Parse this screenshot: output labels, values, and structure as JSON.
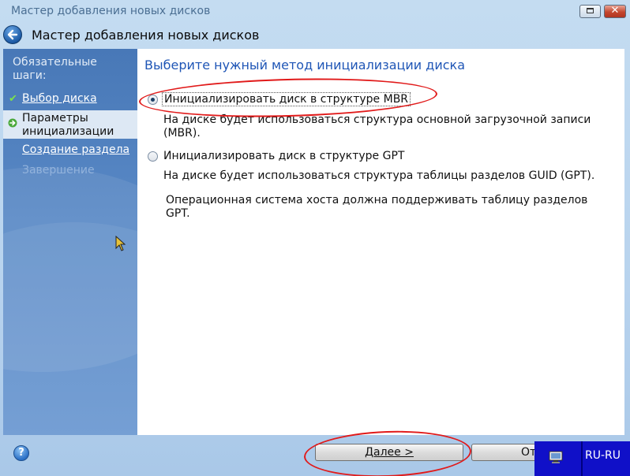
{
  "window": {
    "title": "Мастер добавления новых дисков",
    "header": "Мастер добавления новых дисков"
  },
  "sidebar": {
    "heading": "Обязательные шаги:",
    "steps": [
      {
        "label": "Выбор диска",
        "state": "done"
      },
      {
        "label": "Параметры инициализации",
        "state": "current"
      },
      {
        "label": "Создание раздела",
        "state": "link"
      },
      {
        "label": "Завершение",
        "state": "disabled"
      }
    ]
  },
  "content": {
    "title": "Выберите нужный метод инициализации диска",
    "options": [
      {
        "label": "Инициализировать диск в структуре MBR",
        "selected": true,
        "description": "На диске будет использоваться структура основной загрузочной записи (MBR)."
      },
      {
        "label": "Инициализировать диск в структуре GPT",
        "selected": false,
        "description": "На диске будет использоваться структура таблицы разделов GUID (GPT)."
      }
    ],
    "note": "Операционная система хоста должна поддерживать таблицу разделов GPT."
  },
  "buttons": {
    "next": "Далее >",
    "cancel": "Отмена"
  },
  "tray": {
    "language": "RU-RU"
  },
  "colors": {
    "accent_title": "#1f56b6",
    "sidebar": "#5989c6",
    "annotation": "#e11a1a",
    "tray": "#1010c8"
  },
  "icons": [
    "back-arrow-icon",
    "check-icon",
    "arrow-right-icon",
    "help-icon",
    "keyboard-icon",
    "mouse-cursor-icon"
  ]
}
